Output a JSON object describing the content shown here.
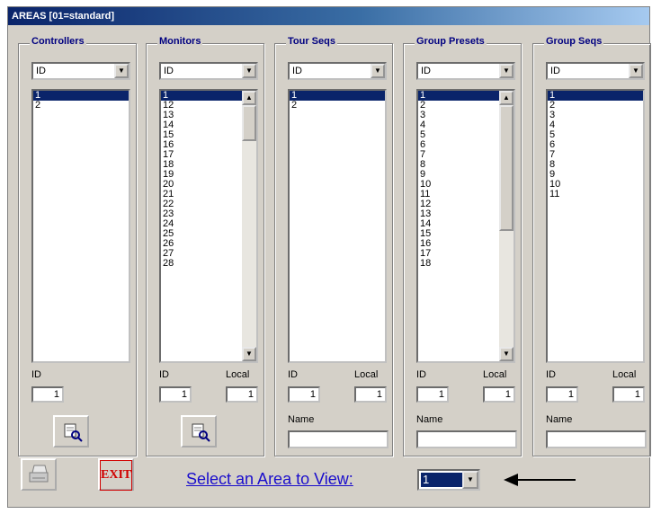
{
  "window": {
    "title": "AREAS  [01=standard]"
  },
  "groups": [
    {
      "label": "Controllers",
      "combo": "ID",
      "items": [
        "1",
        "2"
      ],
      "selected": 0,
      "scroll": false,
      "id_label": "ID",
      "id_value": "1",
      "has_local": false,
      "has_name": false,
      "has_zoom": true
    },
    {
      "label": "Monitors",
      "combo": "ID",
      "items": [
        "1",
        "12",
        "13",
        "14",
        "15",
        "16",
        "17",
        "18",
        "19",
        "20",
        "21",
        "22",
        "23",
        "24",
        "25",
        "26",
        "27",
        "28"
      ],
      "selected": 0,
      "scroll": true,
      "id_label": "ID",
      "id_value": "1",
      "local_label": "Local",
      "local_value": "1",
      "has_local": true,
      "has_name": false,
      "has_zoom": true
    },
    {
      "label": "Tour Seqs",
      "combo": "ID",
      "items": [
        "1",
        "2"
      ],
      "selected": 0,
      "scroll": false,
      "id_label": "ID",
      "id_value": "1",
      "local_label": "Local",
      "local_value": "1",
      "has_local": true,
      "name_label": "Name",
      "has_name": true,
      "has_zoom": false
    },
    {
      "label": "Group Presets",
      "combo": "ID",
      "items": [
        "1",
        "2",
        "3",
        "4",
        "5",
        "6",
        "7",
        "8",
        "9",
        "10",
        "11",
        "12",
        "13",
        "14",
        "15",
        "16",
        "17",
        "18"
      ],
      "selected": 0,
      "scroll": true,
      "id_label": "ID",
      "id_value": "1",
      "local_label": "Local",
      "local_value": "1",
      "has_local": true,
      "name_label": "Name",
      "has_name": true,
      "has_zoom": false
    },
    {
      "label": "Group Seqs",
      "combo": "ID",
      "items": [
        "1",
        "2",
        "3",
        "4",
        "5",
        "6",
        "7",
        "8",
        "9",
        "10",
        "11"
      ],
      "selected": 0,
      "scroll": false,
      "id_label": "ID",
      "id_value": "1",
      "local_label": "Local",
      "local_value": "1",
      "has_local": true,
      "name_label": "Name",
      "has_name": true,
      "has_zoom": false
    }
  ],
  "bottom": {
    "print_icon": "printer-icon",
    "exit_label": "EXIT",
    "select_label": "Select an Area to View:",
    "area_value": "1"
  },
  "colors": {
    "selection": "#0a246a",
    "link": "#1a0dcc",
    "exit": "#d00000",
    "group_label": "#000080"
  }
}
